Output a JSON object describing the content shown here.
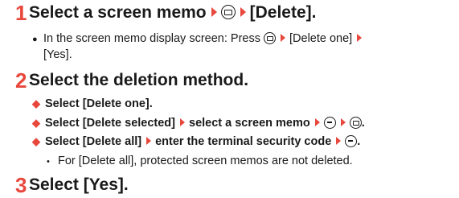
{
  "step1": {
    "number": "1",
    "heading_a": "Select a screen memo",
    "heading_b": "[Delete].",
    "note_a": "In the screen memo display screen: Press",
    "note_b": "[Delete one]",
    "note_c": "[Yes]."
  },
  "step2": {
    "number": "2",
    "heading": "Select the deletion method.",
    "option1": "Select [Delete one].",
    "option2_a": "Select [Delete selected]",
    "option2_b": "select a screen memo",
    "option3_a": "Select [Delete all]",
    "option3_b": "enter the terminal security code",
    "sub_note": "For [Delete all], protected screen memos are not deleted."
  },
  "step3": {
    "number": "3",
    "heading": "Select [Yes]."
  },
  "icons": {
    "arrow": "right-triangle-arrow",
    "camera_key": "camera-key-icon",
    "minus_key": "minus-key-icon",
    "accent": "#e8473c"
  }
}
